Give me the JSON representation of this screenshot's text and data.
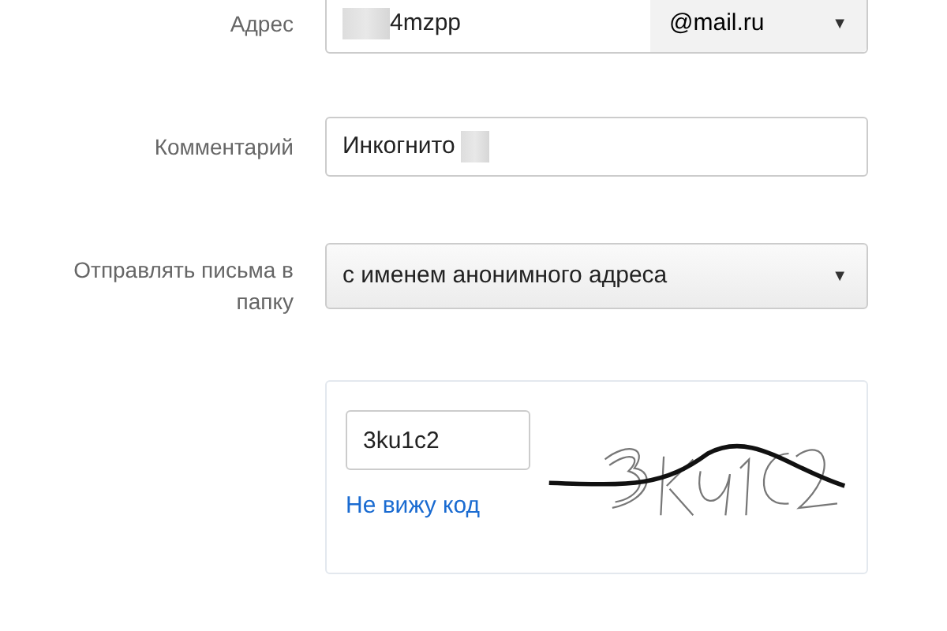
{
  "address": {
    "label": "Адрес",
    "value": "4mzpp",
    "redacted": true,
    "domain": "@mail.ru",
    "caret": "▼"
  },
  "comment": {
    "label": "Комментарий",
    "value": "Инкогнито",
    "redacted": true
  },
  "folder": {
    "label": "Отправлять письма в папку",
    "value": "с именем анонимного адреса",
    "caret": "▼"
  },
  "captcha": {
    "value": "3ku1c2",
    "link": "Не вижу код"
  }
}
